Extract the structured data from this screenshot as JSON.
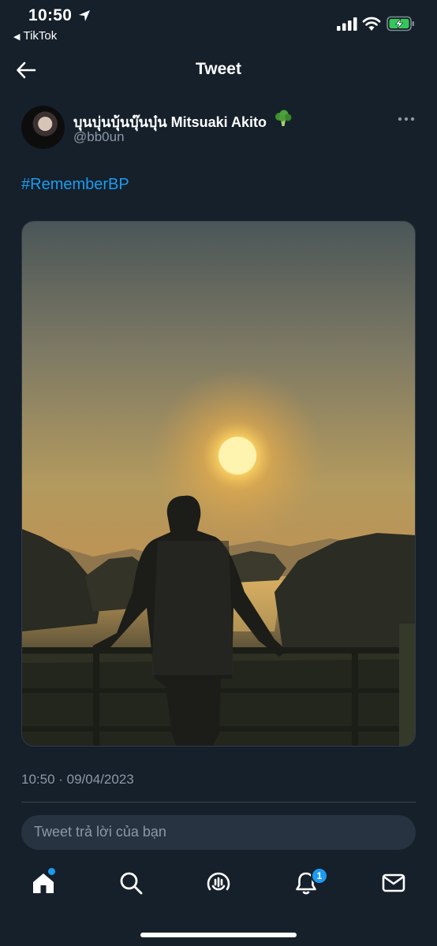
{
  "status_bar": {
    "time": "10:50",
    "back_app": "TikTok",
    "icons": [
      "location-arrow",
      "cellular-signal",
      "wifi",
      "battery-charging"
    ]
  },
  "header": {
    "title": "Tweet",
    "back_icon": "arrow-left"
  },
  "tweet": {
    "display_name": "บุนบุ่นบุ้นบุ๊นบุ๋น Mitsuaki Akito",
    "name_emoji": "broccoli",
    "handle": "@bb0un",
    "text": "#RememberBP",
    "media_alt": "photo",
    "timestamp": "10:50 · 09/04/2023"
  },
  "reply": {
    "placeholder": "Tweet trả lời của bạn"
  },
  "tab_bar": {
    "items": [
      "home",
      "search",
      "spaces",
      "notifications",
      "messages"
    ],
    "notifications_count": "1"
  },
  "colors": {
    "background": "#15202b",
    "accent": "#1d9bf0",
    "secondary_text": "#8b98a5"
  }
}
